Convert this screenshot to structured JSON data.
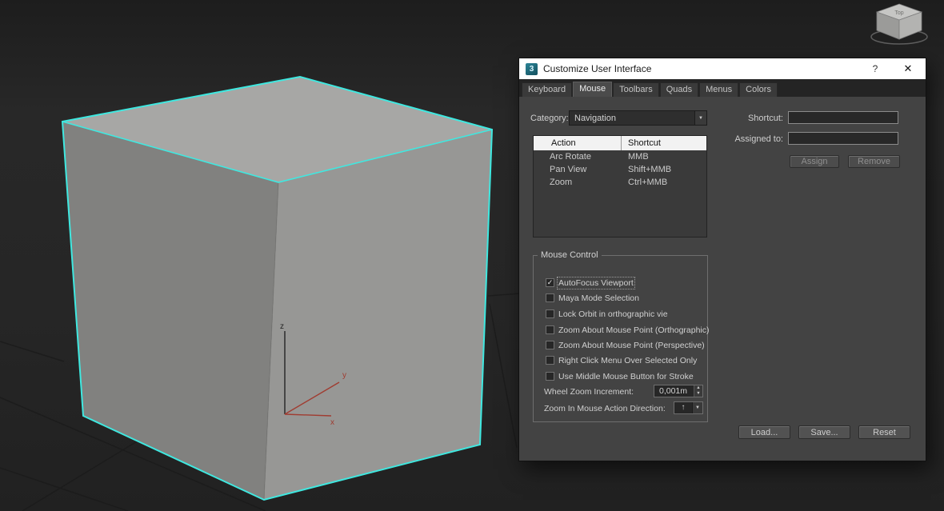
{
  "colors": {
    "selection": "#3fe8e0",
    "cube_top": "#a7a7a5",
    "cube_left": "#81817f",
    "cube_right": "#979795",
    "axis_x": "#a03c31",
    "axis_y": "#a03c31",
    "axis_z": "#242424",
    "grid_line": "#1a1a1a"
  },
  "viewport": {
    "axis_labels": {
      "x": "x",
      "y": "y",
      "z": "z"
    },
    "viewcube": {
      "top_label": "Top"
    }
  },
  "dialog": {
    "title": "Customize User Interface",
    "logo_text": "3",
    "help_label": "?",
    "close_label": "✕",
    "tabs": [
      {
        "label": "Keyboard",
        "selected": false
      },
      {
        "label": "Mouse",
        "selected": true
      },
      {
        "label": "Toolbars",
        "selected": false
      },
      {
        "label": "Quads",
        "selected": false
      },
      {
        "label": "Menus",
        "selected": false
      },
      {
        "label": "Colors",
        "selected": false
      }
    ],
    "category": {
      "label": "Category:",
      "value": "Navigation"
    },
    "shortcut_field": {
      "label": "Shortcut:",
      "value": ""
    },
    "assigned_field": {
      "label": "Assigned to:",
      "value": ""
    },
    "assign_button": "Assign",
    "remove_button": "Remove",
    "action_table": {
      "headers": [
        "Action",
        "Shortcut"
      ],
      "rows": [
        {
          "action": "Arc Rotate",
          "shortcut": "MMB"
        },
        {
          "action": "Pan View",
          "shortcut": "Shift+MMB"
        },
        {
          "action": "Zoom",
          "shortcut": "Ctrl+MMB"
        }
      ]
    },
    "mouse_control": {
      "title": "Mouse Control",
      "checkboxes": [
        {
          "label": "AutoFocus Viewport",
          "checked": true,
          "mark": "✓"
        },
        {
          "label": "Maya Mode Selection",
          "checked": false,
          "mark": ""
        },
        {
          "label": "Lock Orbit in orthographic vie",
          "checked": false,
          "mark": ""
        },
        {
          "label": "Zoom About Mouse Point (Orthographic)",
          "checked": false,
          "mark": ""
        },
        {
          "label": "Zoom About Mouse Point (Perspective)",
          "checked": false,
          "mark": ""
        },
        {
          "label": "Right Click Menu Over Selected Only",
          "checked": false,
          "mark": ""
        },
        {
          "label": "Use Middle Mouse Button for Stroke",
          "checked": false,
          "mark": ""
        }
      ],
      "wheel_zoom": {
        "label": "Wheel Zoom Increment:",
        "value": "0,001m"
      },
      "zoom_direction": {
        "label": "Zoom In Mouse Action Direction:",
        "value": "↑"
      }
    },
    "footer_buttons": [
      {
        "label": "Load..."
      },
      {
        "label": "Save..."
      },
      {
        "label": "Reset"
      }
    ],
    "icons": {
      "dropdown_arrow": "▼",
      "spin_up": "▲",
      "spin_down": "▼"
    }
  }
}
